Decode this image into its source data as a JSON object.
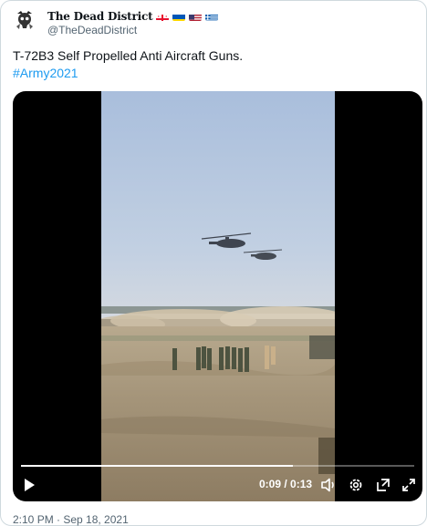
{
  "author": {
    "display_name": "The Dead District",
    "handle": "@TheDeadDistrict",
    "flags": [
      "georgia-flag",
      "ukraine-flag",
      "usa-flag",
      "greece-flag"
    ],
    "avatar_icon": "skull-avatar-icon"
  },
  "tweet": {
    "text": "T-72B3 Self Propelled Anti Aircraft Guns.",
    "hashtag": "#Army2021",
    "timestamp": "2:10 PM · Sep 18, 2021"
  },
  "video": {
    "time_display": "0:09 / 0:13",
    "current_seconds": 9,
    "total_seconds": 13,
    "icons": [
      "play-icon",
      "volume-icon",
      "settings-gear-icon",
      "popout-icon",
      "fullscreen-icon"
    ]
  },
  "colors": {
    "link": "#1d9bf0",
    "secondary_text": "#536471",
    "border": "#cfd9de"
  }
}
